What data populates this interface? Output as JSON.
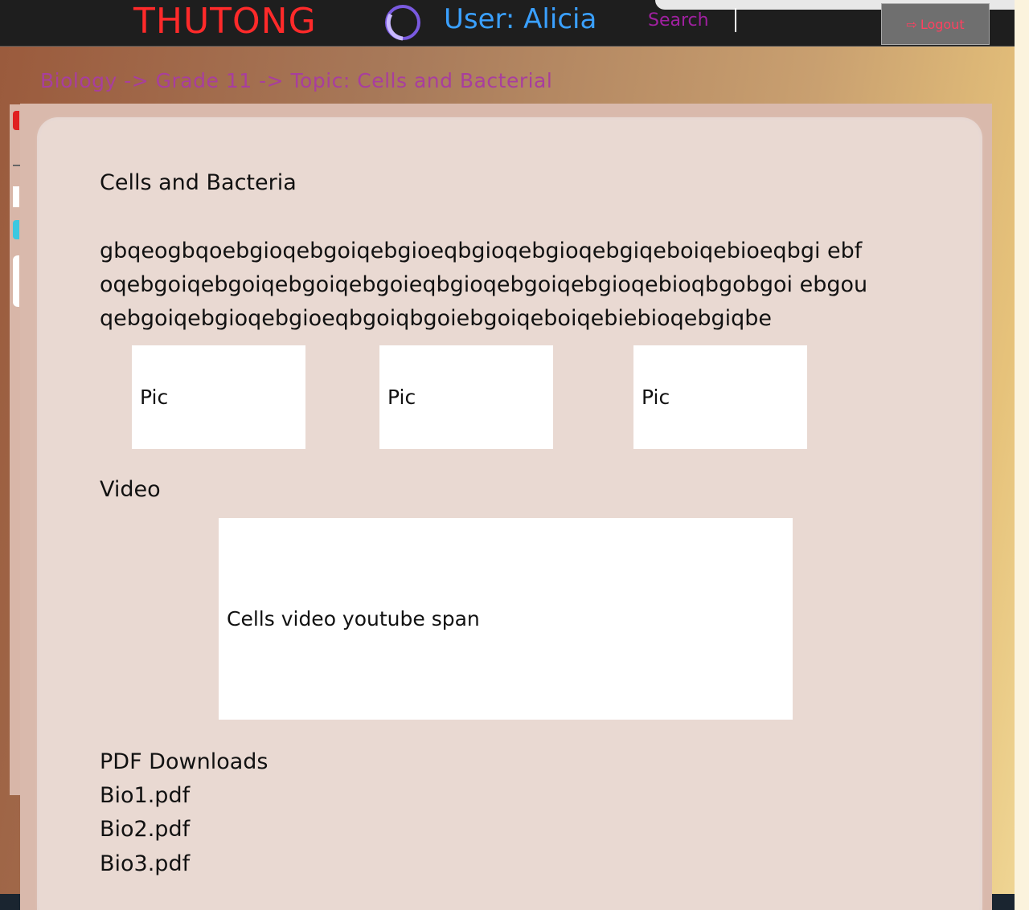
{
  "header": {
    "logo": "THUTONG",
    "user_label": "User: Alicia",
    "search_placeholder": "Search",
    "logout_label": "Logout"
  },
  "breadcrumb": "Biology -> Grade 11 -> Topic: Cells and Bacterial",
  "content": {
    "title": "Cells and Bacteria",
    "body": "gbqeogbqoebgioqebgoiqebgioeqbgioqebgioqebgiqeboiqebioeqbgi ebfoqebgoiqebgoiqebgoiqebgoieqbgioqebgoiqebgioqebioqbgobgoi ebgouqebgoiqebgioqebgioeqbgoiqbgoiebgoiqeboiqebiebioqebgiqbe",
    "pics": [
      "Pic",
      "Pic",
      "Pic"
    ],
    "video_label": "Video",
    "video_placeholder": "Cells video youtube span",
    "pdf_title": "PDF Downloads",
    "pdfs": [
      "Bio1.pdf",
      "Bio2.pdf",
      "Bio3.pdf"
    ]
  },
  "colors": {
    "logo": "#ff2a2a",
    "user": "#3aa0ff",
    "breadcrumb": "#a83e9e",
    "logout": "#ff4060"
  }
}
